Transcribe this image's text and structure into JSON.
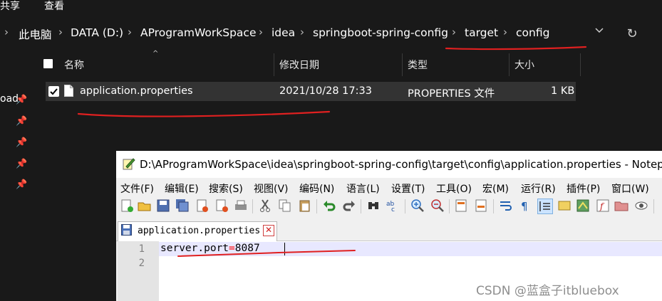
{
  "explorer": {
    "ribbon": {
      "share_label": "共享",
      "view_label": "查看"
    },
    "breadcrumb": [
      "此电脑",
      "DATA (D:)",
      "AProgramWorkSpace",
      "idea",
      "springboot-spring-config",
      "target",
      "config"
    ],
    "nav_pane": {
      "partial_label": "oad"
    },
    "columns": {
      "name": "名称",
      "modified": "修改日期",
      "type": "类型",
      "size": "大小"
    },
    "files": [
      {
        "name": "application.properties",
        "modified": "2021/10/28 17:33",
        "type": "PROPERTIES 文件",
        "size": "1 KB",
        "checked": true
      }
    ]
  },
  "notepadpp": {
    "title": "D:\\AProgramWorkSpace\\idea\\springboot-spring-config\\target\\config\\application.properties - Notep",
    "menu": [
      "文件(F)",
      "编辑(E)",
      "搜索(S)",
      "视图(V)",
      "编码(N)",
      "语言(L)",
      "设置(T)",
      "工具(O)",
      "宏(M)",
      "运行(R)",
      "插件(P)",
      "窗口(W)"
    ],
    "tab": {
      "label": "application.properties",
      "close": "✕"
    },
    "lines": [
      {
        "number": "1",
        "key": "server.port",
        "op": "=",
        "value": "8087"
      },
      {
        "number": "2"
      }
    ]
  },
  "watermark": "CSDN @蓝盒子itbluebox",
  "colors": {
    "annotation": "#e02020",
    "explorer_bg": "#191919",
    "selected_row": "#333333"
  }
}
